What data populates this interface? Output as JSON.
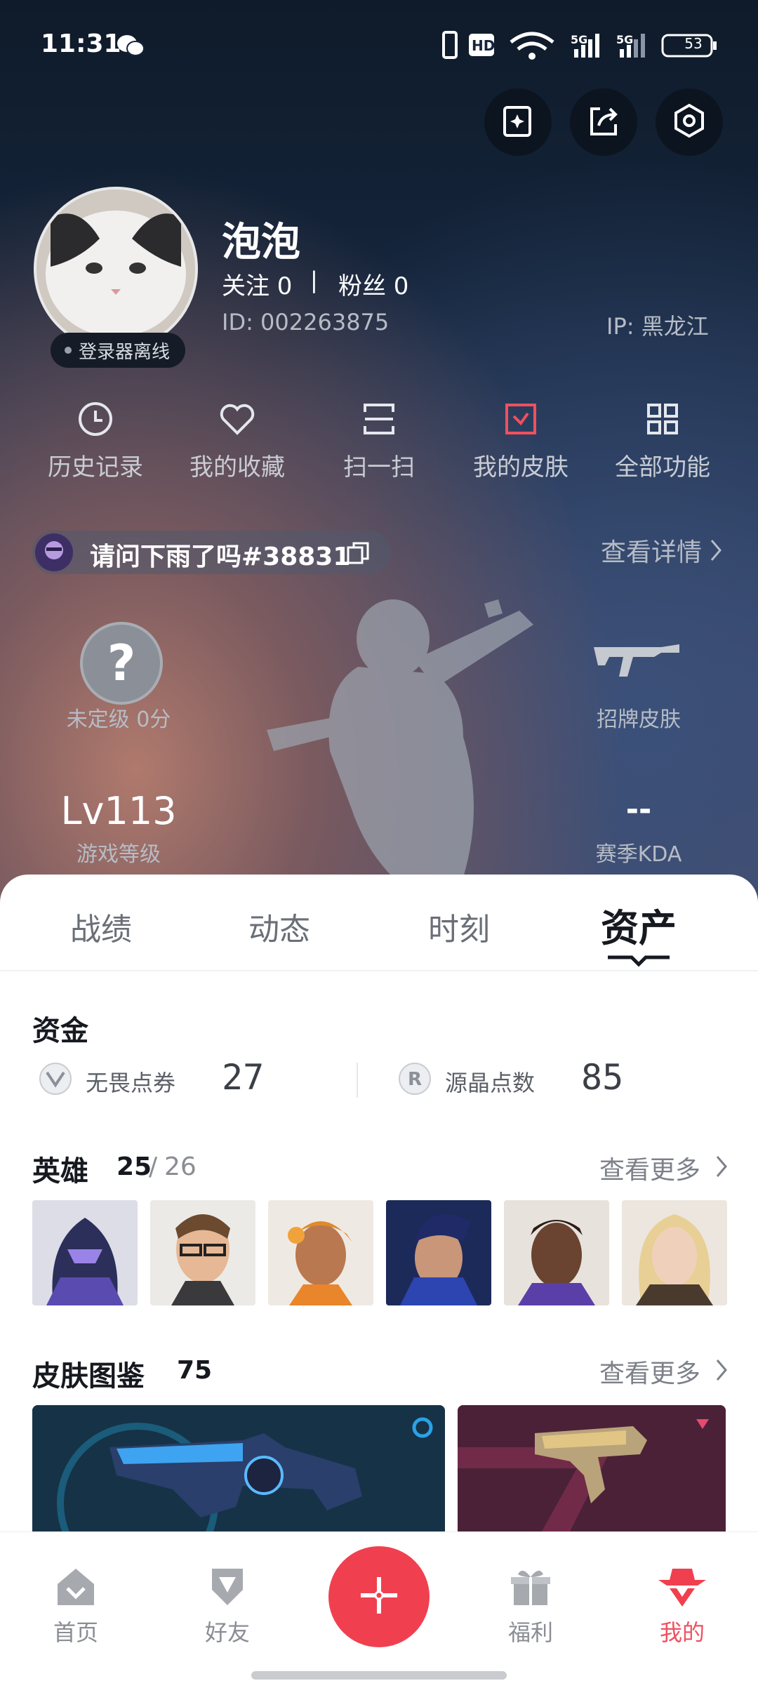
{
  "status_bar": {
    "time": "11:31",
    "battery": "53"
  },
  "profile": {
    "name": "泡泡",
    "follow_label": "关注 0",
    "divider": "|",
    "fans_label": "粉丝 0",
    "id_text": "ID:  002263875",
    "ip_text": "IP:  黑龙江",
    "status_badge": "登录器离线"
  },
  "menu": [
    {
      "label": "历史记录",
      "icon": "history-icon"
    },
    {
      "label": "我的收藏",
      "icon": "heart-icon"
    },
    {
      "label": "扫一扫",
      "icon": "scan-icon"
    },
    {
      "label": "我的皮肤",
      "icon": "skin-icon"
    },
    {
      "label": "全部功能",
      "icon": "grid-icon"
    }
  ],
  "game_account": {
    "name": "请问下雨了吗#38831",
    "detail_link": "查看详情"
  },
  "stats": {
    "rank_label": "未定级 0分",
    "signature_skin_label": "招牌皮肤",
    "level_value": "Lv113",
    "level_label": "游戏等级",
    "kda_value": "--",
    "kda_label": "赛季KDA"
  },
  "tabs": [
    "战绩",
    "动态",
    "时刻",
    "资产"
  ],
  "active_tab": "资产",
  "funds": {
    "title": "资金",
    "items": [
      {
        "label": "无畏点券",
        "value": "27"
      },
      {
        "label": "源晶点数",
        "value": "85"
      }
    ]
  },
  "heroes": {
    "title": "英雄",
    "owned": "25",
    "separator": "/",
    "total": "26",
    "more": "查看更多"
  },
  "skins": {
    "title": "皮肤图鉴",
    "count": "75",
    "more": "查看更多"
  },
  "bottom_nav": [
    {
      "label": "首页",
      "icon": "home-icon"
    },
    {
      "label": "好友",
      "icon": "friends-icon"
    },
    {
      "label": "",
      "icon": "plus-icon"
    },
    {
      "label": "福利",
      "icon": "gift-icon"
    },
    {
      "label": "我的",
      "icon": "profile-icon"
    }
  ],
  "colors": {
    "accent": "#f0505f",
    "sheet_bg": "#ffffff",
    "hero_bg": "#14243a"
  }
}
